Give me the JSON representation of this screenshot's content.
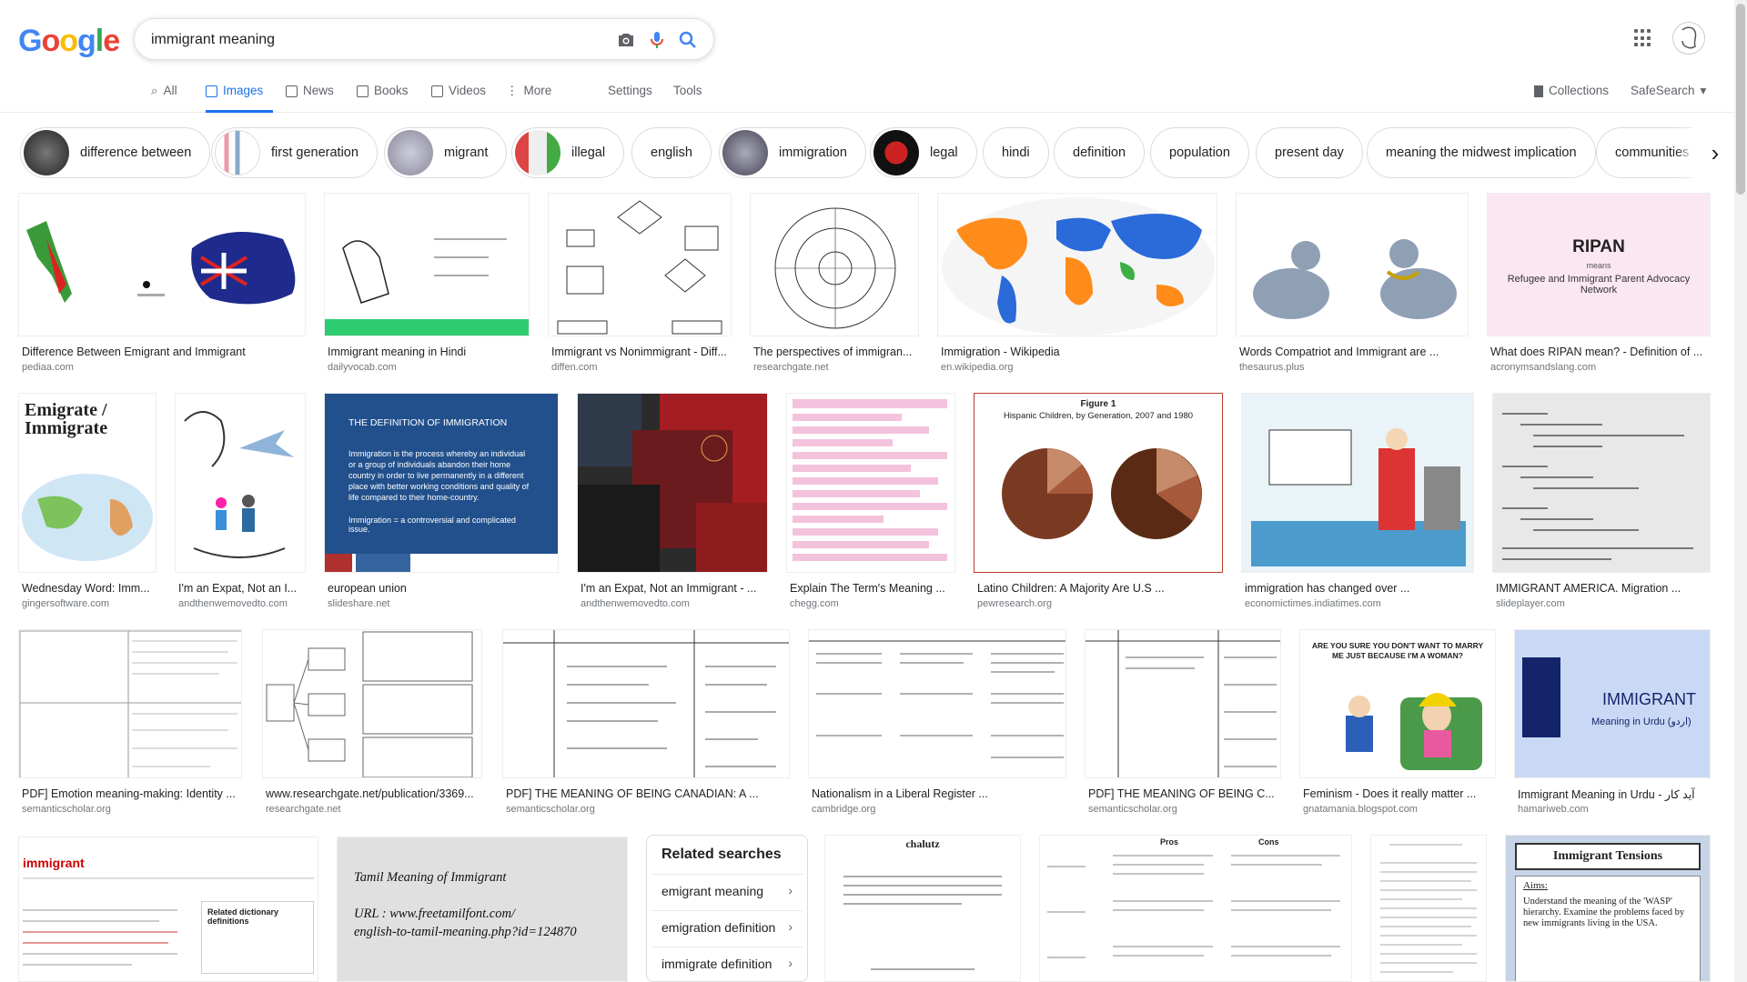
{
  "logo": {
    "letters": [
      "G",
      "o",
      "o",
      "g",
      "l",
      "e"
    ]
  },
  "search": {
    "query": "immigrant meaning"
  },
  "tabs": [
    {
      "label": "All"
    },
    {
      "label": "Images"
    },
    {
      "label": "News"
    },
    {
      "label": "Books"
    },
    {
      "label": "Videos"
    },
    {
      "label": "More"
    },
    {
      "label": "Settings"
    },
    {
      "label": "Tools"
    }
  ],
  "header_right": {
    "collections": "Collections",
    "safesearch": "SafeSearch"
  },
  "chips": [
    {
      "label": "difference between"
    },
    {
      "label": "first generation"
    },
    {
      "label": "migrant"
    },
    {
      "label": "illegal"
    },
    {
      "label": "english"
    },
    {
      "label": "immigration"
    },
    {
      "label": "legal"
    },
    {
      "label": "hindi"
    },
    {
      "label": "definition"
    },
    {
      "label": "population"
    },
    {
      "label": "present day"
    },
    {
      "label": "meaning the midwest implication"
    },
    {
      "label": "communities s"
    }
  ],
  "results": [
    {
      "caption": "Difference Between Emigrant and Immigrant",
      "source": "pediaa.com"
    },
    {
      "caption": "Immigrant meaning in Hindi",
      "source": "dailyvocab.com"
    },
    {
      "caption": "Immigrant vs Nonimmigrant - Diff...",
      "source": "diffen.com"
    },
    {
      "caption": "The perspectives of immigran...",
      "source": "researchgate.net"
    },
    {
      "caption": "Immigration - Wikipedia",
      "source": "en.wikipedia.org"
    },
    {
      "caption": "Words Compatriot and Immigrant are ...",
      "source": "thesaurus.plus"
    },
    {
      "caption": "What does RIPAN mean? - Definition of ...",
      "source": "acronymsandslang.com"
    },
    {
      "caption": "Wednesday Word: Imm...",
      "source": "gingersoftware.com"
    },
    {
      "caption": "I'm an Expat, Not an I...",
      "source": "andthenwemovedto.com"
    },
    {
      "caption": "european union",
      "source": "slideshare.net"
    },
    {
      "caption": "I'm an Expat, Not an Immigrant - ...",
      "source": "andthenwemovedto.com"
    },
    {
      "caption": "Explain The Term's Meaning ...",
      "source": "chegg.com"
    },
    {
      "caption": "Latino Children: A Majority Are U.S ...",
      "source": "pewresearch.org"
    },
    {
      "caption": "immigration has changed over ...",
      "source": "economictimes.indiatimes.com"
    },
    {
      "caption": "IMMIGRANT AMERICA. Migration ...",
      "source": "slideplayer.com"
    },
    {
      "caption": "PDF] Emotion meaning-making: Identity ...",
      "source": "semanticscholar.org"
    },
    {
      "caption": "www.researchgate.net/publication/3369...",
      "source": "researchgate.net"
    },
    {
      "caption": "PDF] THE MEANING OF BEING CANADIAN: A ...",
      "source": "semanticscholar.org"
    },
    {
      "caption": "Nationalism in a Liberal Register ...",
      "source": "cambridge.org"
    },
    {
      "caption": "PDF] THE MEANING OF BEING C...",
      "source": "semanticscholar.org"
    },
    {
      "caption": "Feminism - Does it really matter ...",
      "source": "gnatamania.blogspot.com"
    },
    {
      "caption": "Immigrant Meaning in Urdu - آید کار",
      "source": "hamariweb.com"
    }
  ],
  "image_text": {
    "ripan_title": "RIPAN",
    "ripan_means": "means",
    "ripan_full": "Refugee and Immigrant Parent Advocacy Network",
    "emigrate_title": "Emigrate / Immigrate",
    "def_title": "THE DEFINITION OF IMMIGRATION",
    "def_body": "Immigration is the process whereby an individual or a group of individuals abandon their home country in order to live permanently in a different place with better working conditions and quality of life compared to their home-country.",
    "def_body2": "Immigration = a controversial and complicated issue.",
    "pew_figure": "Figure 1",
    "pew_title": "Hispanic Children, by Generation, 2007 and 1980",
    "urdu_title": "IMMIGRANT",
    "urdu_sub": "Meaning in Urdu (اردو)",
    "tamil_line1": "Tamil Meaning of Immigrant",
    "tamil_line2": "URL : www.freetamilfont.com/",
    "tamil_line3": "english-to-tamil-meaning.php?id=124870",
    "tensions_title": "Immigrant Tensions",
    "tensions_aims": "Aims:",
    "tensions_body": "Understand the meaning of the 'WASP' hierarchy. Examine the problems faced by new immigrants living in the USA.",
    "feminism_text": "ARE YOU SURE YOU DON'T WANT TO MARRY ME JUST BECAUSE I'M A WOMAN?",
    "dict_word": "immigrant",
    "dict_related": "Related dictionary definitions",
    "chalutz": "chalutz",
    "pros": "Pros",
    "cons": "Cons"
  },
  "related": {
    "heading": "Related searches",
    "items": [
      {
        "label": "emigrant meaning"
      },
      {
        "label": "emigration definition"
      },
      {
        "label": "immigrate definition"
      }
    ]
  },
  "colors": {
    "accent": "#1a73e8",
    "link_gray": "#70757a"
  }
}
